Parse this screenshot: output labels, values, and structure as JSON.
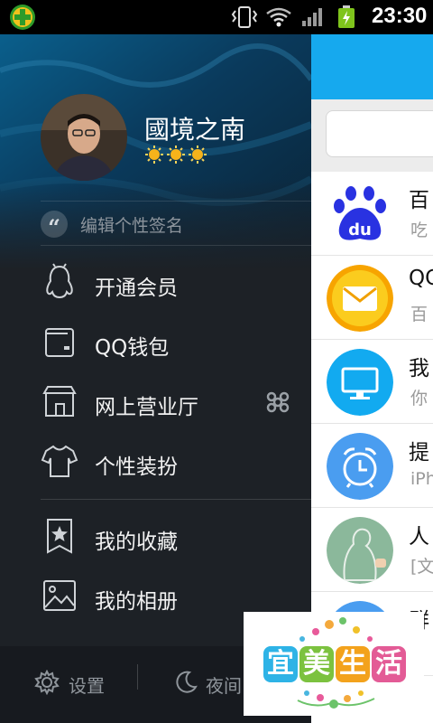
{
  "status_bar": {
    "time": "23:30",
    "icons": [
      "360-security-icon",
      "vibrate-icon",
      "wifi-icon",
      "signal-icon",
      "battery-charging-icon"
    ]
  },
  "drawer": {
    "profile": {
      "name": "國境之南",
      "level_icons": [
        "sun-icon",
        "sun-icon",
        "sun-icon"
      ]
    },
    "signature_placeholder": "编辑个性签名",
    "menu": [
      {
        "label": "开通会员",
        "icon": "penguin-icon"
      },
      {
        "label": "QQ钱包",
        "icon": "wallet-icon"
      },
      {
        "label": "网上营业厅",
        "icon": "store-icon",
        "badge_icon": "china-unicom-icon"
      },
      {
        "label": "个性装扮",
        "icon": "tshirt-icon"
      },
      {
        "label": "我的收藏",
        "icon": "bookmark-star-icon"
      },
      {
        "label": "我的相册",
        "icon": "photo-album-icon"
      }
    ],
    "footer": {
      "settings_label": "设置",
      "night_label": "夜间"
    }
  },
  "conversations": [
    {
      "title": "百",
      "subtitle": "吃",
      "icon": "baidu-icon"
    },
    {
      "title": "QC",
      "subtitle": "百",
      "icon": "mail-icon"
    },
    {
      "title": "我",
      "subtitle": "你",
      "icon": "computer-icon"
    },
    {
      "title": "提",
      "subtitle": "iPh",
      "icon": "alarm-clock-icon"
    },
    {
      "title": "人",
      "subtitle": "[文",
      "icon": "blackboard-icon"
    },
    {
      "title": "群",
      "subtitle": "",
      "icon": "group-icon"
    }
  ],
  "watermark": {
    "chars": [
      "宜",
      "美",
      "生",
      "活"
    ]
  },
  "colors": {
    "accent_blue": "#16a9ee",
    "drawer_bg": "#1d2126"
  }
}
